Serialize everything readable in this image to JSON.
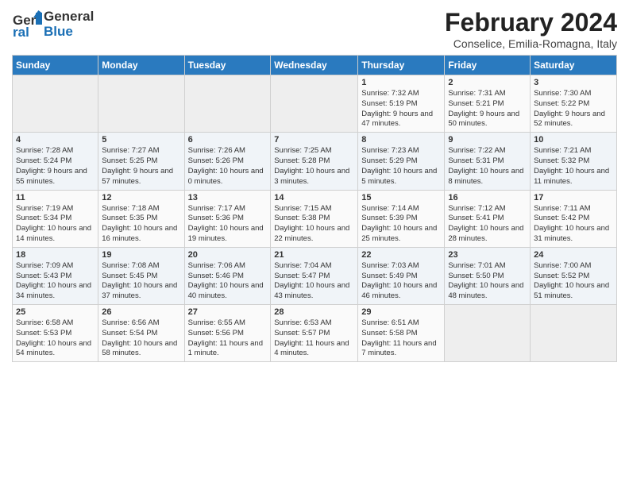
{
  "header": {
    "logo_general": "General",
    "logo_blue": "Blue",
    "title": "February 2024",
    "subtitle": "Conselice, Emilia-Romagna, Italy"
  },
  "calendar": {
    "days_of_week": [
      "Sunday",
      "Monday",
      "Tuesday",
      "Wednesday",
      "Thursday",
      "Friday",
      "Saturday"
    ],
    "weeks": [
      [
        {
          "day": "",
          "info": ""
        },
        {
          "day": "",
          "info": ""
        },
        {
          "day": "",
          "info": ""
        },
        {
          "day": "",
          "info": ""
        },
        {
          "day": "1",
          "info": "Sunrise: 7:32 AM\nSunset: 5:19 PM\nDaylight: 9 hours and 47 minutes."
        },
        {
          "day": "2",
          "info": "Sunrise: 7:31 AM\nSunset: 5:21 PM\nDaylight: 9 hours and 50 minutes."
        },
        {
          "day": "3",
          "info": "Sunrise: 7:30 AM\nSunset: 5:22 PM\nDaylight: 9 hours and 52 minutes."
        }
      ],
      [
        {
          "day": "4",
          "info": "Sunrise: 7:28 AM\nSunset: 5:24 PM\nDaylight: 9 hours and 55 minutes."
        },
        {
          "day": "5",
          "info": "Sunrise: 7:27 AM\nSunset: 5:25 PM\nDaylight: 9 hours and 57 minutes."
        },
        {
          "day": "6",
          "info": "Sunrise: 7:26 AM\nSunset: 5:26 PM\nDaylight: 10 hours and 0 minutes."
        },
        {
          "day": "7",
          "info": "Sunrise: 7:25 AM\nSunset: 5:28 PM\nDaylight: 10 hours and 3 minutes."
        },
        {
          "day": "8",
          "info": "Sunrise: 7:23 AM\nSunset: 5:29 PM\nDaylight: 10 hours and 5 minutes."
        },
        {
          "day": "9",
          "info": "Sunrise: 7:22 AM\nSunset: 5:31 PM\nDaylight: 10 hours and 8 minutes."
        },
        {
          "day": "10",
          "info": "Sunrise: 7:21 AM\nSunset: 5:32 PM\nDaylight: 10 hours and 11 minutes."
        }
      ],
      [
        {
          "day": "11",
          "info": "Sunrise: 7:19 AM\nSunset: 5:34 PM\nDaylight: 10 hours and 14 minutes."
        },
        {
          "day": "12",
          "info": "Sunrise: 7:18 AM\nSunset: 5:35 PM\nDaylight: 10 hours and 16 minutes."
        },
        {
          "day": "13",
          "info": "Sunrise: 7:17 AM\nSunset: 5:36 PM\nDaylight: 10 hours and 19 minutes."
        },
        {
          "day": "14",
          "info": "Sunrise: 7:15 AM\nSunset: 5:38 PM\nDaylight: 10 hours and 22 minutes."
        },
        {
          "day": "15",
          "info": "Sunrise: 7:14 AM\nSunset: 5:39 PM\nDaylight: 10 hours and 25 minutes."
        },
        {
          "day": "16",
          "info": "Sunrise: 7:12 AM\nSunset: 5:41 PM\nDaylight: 10 hours and 28 minutes."
        },
        {
          "day": "17",
          "info": "Sunrise: 7:11 AM\nSunset: 5:42 PM\nDaylight: 10 hours and 31 minutes."
        }
      ],
      [
        {
          "day": "18",
          "info": "Sunrise: 7:09 AM\nSunset: 5:43 PM\nDaylight: 10 hours and 34 minutes."
        },
        {
          "day": "19",
          "info": "Sunrise: 7:08 AM\nSunset: 5:45 PM\nDaylight: 10 hours and 37 minutes."
        },
        {
          "day": "20",
          "info": "Sunrise: 7:06 AM\nSunset: 5:46 PM\nDaylight: 10 hours and 40 minutes."
        },
        {
          "day": "21",
          "info": "Sunrise: 7:04 AM\nSunset: 5:47 PM\nDaylight: 10 hours and 43 minutes."
        },
        {
          "day": "22",
          "info": "Sunrise: 7:03 AM\nSunset: 5:49 PM\nDaylight: 10 hours and 46 minutes."
        },
        {
          "day": "23",
          "info": "Sunrise: 7:01 AM\nSunset: 5:50 PM\nDaylight: 10 hours and 48 minutes."
        },
        {
          "day": "24",
          "info": "Sunrise: 7:00 AM\nSunset: 5:52 PM\nDaylight: 10 hours and 51 minutes."
        }
      ],
      [
        {
          "day": "25",
          "info": "Sunrise: 6:58 AM\nSunset: 5:53 PM\nDaylight: 10 hours and 54 minutes."
        },
        {
          "day": "26",
          "info": "Sunrise: 6:56 AM\nSunset: 5:54 PM\nDaylight: 10 hours and 58 minutes."
        },
        {
          "day": "27",
          "info": "Sunrise: 6:55 AM\nSunset: 5:56 PM\nDaylight: 11 hours and 1 minute."
        },
        {
          "day": "28",
          "info": "Sunrise: 6:53 AM\nSunset: 5:57 PM\nDaylight: 11 hours and 4 minutes."
        },
        {
          "day": "29",
          "info": "Sunrise: 6:51 AM\nSunset: 5:58 PM\nDaylight: 11 hours and 7 minutes."
        },
        {
          "day": "",
          "info": ""
        },
        {
          "day": "",
          "info": ""
        }
      ]
    ]
  }
}
